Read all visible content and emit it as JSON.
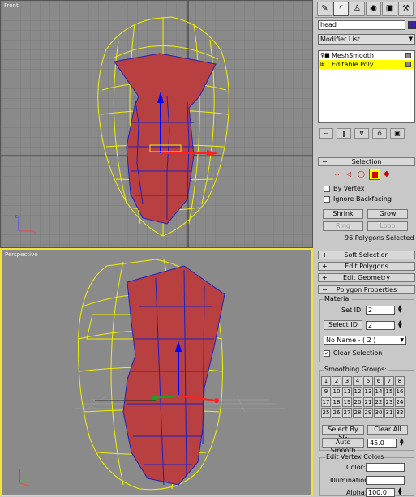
{
  "viewports": {
    "front": {
      "label": "Front"
    },
    "perspective": {
      "label": "Perspective"
    }
  },
  "panel": {
    "tabs": [
      {
        "name": "create-tab",
        "glyph": "✎"
      },
      {
        "name": "modify-tab",
        "glyph": "◜"
      },
      {
        "name": "hierarchy-tab",
        "glyph": "♙"
      },
      {
        "name": "motion-tab",
        "glyph": "◉"
      },
      {
        "name": "display-tab",
        "glyph": "▣"
      },
      {
        "name": "utilities-tab",
        "glyph": "⚒"
      }
    ],
    "object_name": "head",
    "object_color": "#4020a0",
    "modifier_list": "Modifier List",
    "stack": [
      {
        "label": "MeshSmooth",
        "selected": false
      },
      {
        "label": "Editable Poly",
        "selected": true
      }
    ],
    "selection": {
      "title": "Selection",
      "by_vertex": "By Vertex",
      "ignore_backfacing": "Ignore Backfacing",
      "shrink": "Shrink",
      "grow": "Grow",
      "ring": "Ring",
      "loop": "Loop",
      "status": "96 Polygons Selected"
    },
    "rollouts": {
      "soft_selection": "Soft Selection",
      "edit_polygons": "Edit Polygons",
      "edit_geometry": "Edit Geometry",
      "polygon_properties": "Polygon Properties"
    },
    "material": {
      "title": "Material",
      "set_id_label": "Set ID:",
      "set_id_value": "2",
      "select_id_label": "Select ID",
      "select_id_value": "2",
      "name_dropdown": "No Name - ( 2 )",
      "clear_selection": "Clear Selection"
    },
    "smoothing": {
      "title": "Smoothing Groups:",
      "groups": [
        "1",
        "2",
        "3",
        "4",
        "5",
        "6",
        "7",
        "8",
        "9",
        "10",
        "11",
        "12",
        "13",
        "14",
        "15",
        "16",
        "17",
        "18",
        "19",
        "20",
        "21",
        "22",
        "23",
        "24",
        "25",
        "26",
        "27",
        "28",
        "29",
        "30",
        "31",
        "32"
      ],
      "select_by_sg": "Select By SG",
      "clear_all": "Clear All",
      "auto_smooth": "Auto Smooth",
      "auto_smooth_value": "45.0"
    },
    "vertex_colors": {
      "title": "Edit Vertex Colors",
      "color": "Color:",
      "illumination": "Illumination:",
      "alpha": "Alpha:",
      "alpha_value": "100.0"
    }
  }
}
